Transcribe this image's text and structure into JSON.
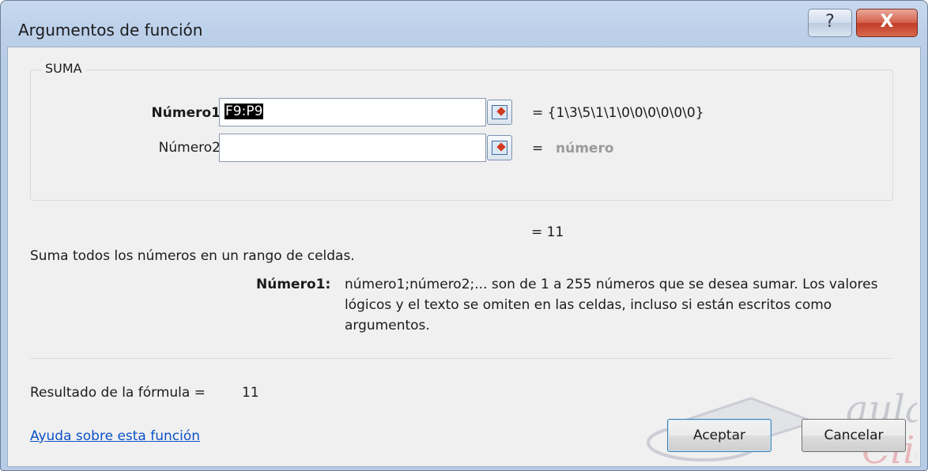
{
  "window": {
    "title": "Argumentos de función"
  },
  "titlebar": {
    "help_glyph": "?",
    "close_glyph": "X"
  },
  "group": {
    "title": "SUMA"
  },
  "args": [
    {
      "label": "Número1",
      "value": "F9:P9",
      "result": "=  {1\\3\\5\\1\\1\\0\\0\\0\\0\\0\\0}"
    },
    {
      "label": "Número2",
      "value": "",
      "result_eq": "=",
      "result": "número"
    }
  ],
  "formula_result": "=  11",
  "description": "Suma todos los números en un rango de celdas.",
  "arg_help": {
    "label": "Número1:",
    "text": "número1;número2;... son de 1 a 255 números que se desea sumar. Los valores lógicos y el texto se omiten en las celdas, incluso si están escritos como argumentos."
  },
  "result_line": {
    "label": "Resultado de la fórmula =",
    "value": "11"
  },
  "help_link": "Ayuda sobre esta función",
  "buttons": {
    "ok": "Aceptar",
    "cancel": "Cancelar"
  },
  "watermark": {
    "text": "aula Clic"
  }
}
